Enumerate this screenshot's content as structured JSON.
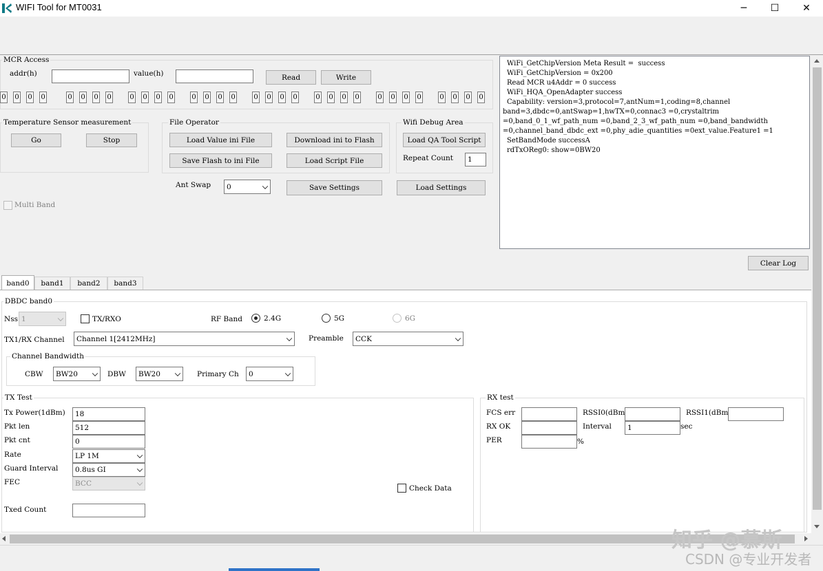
{
  "window": {
    "title": "WIFI Tool for MT0031",
    "minimize": "─",
    "maximize": "☐",
    "close": "✕"
  },
  "mcr": {
    "group_label": "MCR Access",
    "addr_label": "addr(h)",
    "addr_value": "",
    "value_label": "value(h)",
    "value_value": "",
    "read_label": "Read",
    "write_label": "Write",
    "bits": [
      "0",
      "0",
      "0",
      "0",
      "0",
      "0",
      "0",
      "0",
      "0",
      "0",
      "0",
      "0",
      "0",
      "0",
      "0",
      "0",
      "0",
      "0",
      "0",
      "0",
      "0",
      "0",
      "0",
      "0",
      "0",
      "0",
      "0",
      "0",
      "0",
      "0",
      "0",
      "0"
    ]
  },
  "temp": {
    "group_label": "Temperature Sensor measurement",
    "go_label": "Go",
    "stop_label": "Stop"
  },
  "file_op": {
    "group_label": "File Operator",
    "load_value_label": "Load Value ini File",
    "download_label": "Download ini to Flash",
    "save_flash_label": "Save Flash to ini File",
    "load_script_label": "Load Script File"
  },
  "debug": {
    "group_label": "Wifi Debug Area",
    "load_qa_label": "Load QA Tool Script",
    "repeat_label": "Repeat Count",
    "repeat_value": "1"
  },
  "ant_swap": {
    "label": "Ant Swap",
    "value": "0"
  },
  "save_settings_label": "Save Settings",
  "load_settings_label": "Load Settings",
  "multi_band_label": "Multi Band",
  "log": {
    "lines": [
      "WiFi_GetChipVersion Meta Result =  success",
      "WiFi_GetChipVersion = 0x200",
      "Read MCR u4Addr = 0 success",
      "WiFi_HQA_OpenAdapter success",
      "Capability: version=3,protocol=7,antNum=1,coding=8,channel",
      "band=3,dbdc=0,antSwap=1,hwTX=0,connac3 =0,crystaltrim",
      "=0,band_0_1_wf_path_num =0,band_2_3_wf_path_num =0,band_bandwidth",
      "=0,channel_band_dbdc_ext =0,phy_adie_quantities =0ext_value.Feature1 =1",
      "SetBandMode successA",
      "rdTxOReg0: show=0BW20"
    ],
    "clear_label": "Clear Log"
  },
  "tabs": [
    "band0",
    "band1",
    "band2",
    "band3"
  ],
  "band0": {
    "dbdc_label": "DBDC band0",
    "nss_label": "Nss",
    "nss_value": "1",
    "txrx_label": "TX/RXO",
    "rf_band_label": "RF Band",
    "rf_24": "2.4G",
    "rf_5": "5G",
    "rf_6": "6G",
    "channel_label": "TX1/RX Channel",
    "channel_value": "Channel 1[2412MHz]",
    "preamble_label": "Preamble",
    "preamble_value": "CCK",
    "bw": {
      "group_label": "Channel Bandwidth",
      "cbw_label": "CBW",
      "cbw_value": "BW20",
      "dbw_label": "DBW",
      "dbw_value": "BW20",
      "primary_label": "Primary Ch",
      "primary_value": "0"
    },
    "tx": {
      "group_label": "TX Test",
      "power_label": "Tx Power(1dBm)",
      "power_value": "18",
      "pkt_len_label": "Pkt len",
      "pkt_len_value": "512",
      "pkt_cnt_label": "Pkt cnt",
      "pkt_cnt_value": "0",
      "rate_label": "Rate",
      "rate_value": "LP 1M",
      "guard_label": "Guard Interval",
      "guard_value": "0.8us GI",
      "fec_label": "FEC",
      "fec_value": "BCC",
      "txed_label": "Txed Count",
      "txed_value": "",
      "check_data_label": "Check Data"
    },
    "rx": {
      "group_label": "RX test",
      "fcs_label": "FCS err",
      "fcs_value": "",
      "rssi0_label": "RSSI0(dBm)",
      "rssi0_value": "",
      "rssi1_label": "RSSI1(dBm)",
      "rssi1_value": "",
      "rxok_label": "RX OK",
      "rxok_value": "",
      "interval_label": "Interval",
      "interval_value": "1",
      "sec_label": "sec",
      "per_label": "PER",
      "per_value": "",
      "percent_label": "%"
    }
  },
  "watermark": {
    "line1": "知乎 @慕斯",
    "line2": "CSDN @专业开发者"
  }
}
